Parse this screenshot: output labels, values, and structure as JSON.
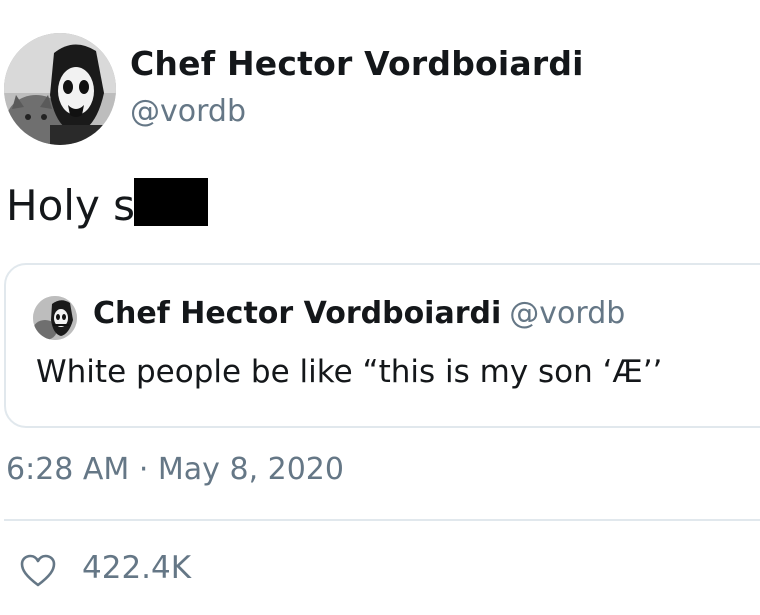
{
  "tweet": {
    "display_name": "Chef Hector Vordboiardi",
    "handle": "@vordb",
    "text": "Holy s",
    "timestamp": "6:28 AM · May 8, 2020",
    "likes": "422.4K"
  },
  "quoted_tweet": {
    "display_name": "Chef Hector Vordboiardi",
    "handle": "@vordb",
    "text": "White people be like “this is my son ‘Æ’’"
  },
  "icons": {
    "like": "heart-outline-icon",
    "avatar": "avatar-image",
    "quote_avatar": "avatar-image"
  },
  "colors": {
    "text": "#14171a",
    "secondary_text": "#657786",
    "border": "#e1e8ed",
    "redaction": "#000000"
  }
}
